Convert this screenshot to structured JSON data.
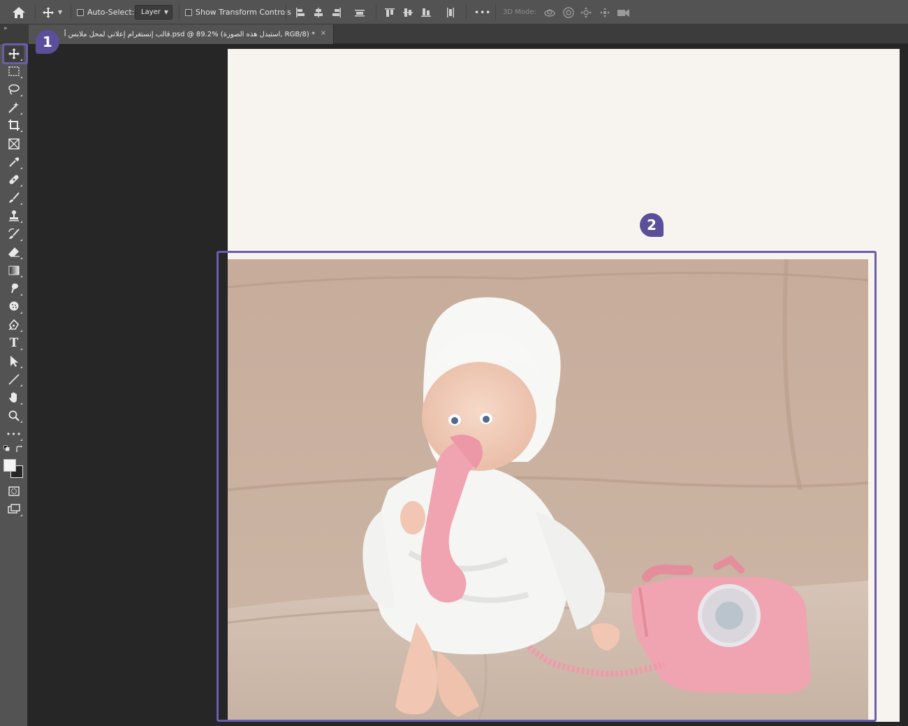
{
  "options_bar": {
    "auto_select_label": "Auto-Select:",
    "layer_select_value": "Layer",
    "show_transform_label": "Show Transform Controls",
    "more_label": "•••",
    "mode_3d_label": "3D Mode:"
  },
  "document_tab": {
    "title": "قالب إنستغرام إعلاني لمحل ملابس أ.psd @ 89.2% (استبدل هذه الصورة, RGB/8) *",
    "close_label": "×"
  },
  "panel_collapse_label": "»",
  "toolbar": {
    "tools": [
      "move",
      "rectangular-marquee",
      "lasso",
      "magic-wand",
      "crop",
      "frame",
      "eyedropper",
      "healing-brush",
      "brush",
      "clone-stamp",
      "history-brush",
      "eraser",
      "gradient",
      "blur",
      "dodge",
      "pen",
      "type",
      "path-selection",
      "line",
      "hand",
      "zoom",
      "edit-toolbar",
      "default-colors",
      "foreground-background",
      "quick-mask",
      "screen-mode"
    ],
    "type_tool_glyph": "T",
    "more_glyph": "•••"
  },
  "callouts": {
    "first": "1",
    "second": "2"
  },
  "colors": {
    "accent": "#6b5ea8",
    "callout": "#5b4f9a",
    "artboard": "#f7f3ef",
    "sofa": "#c9b2a1",
    "phone": "#f0a3b0"
  }
}
